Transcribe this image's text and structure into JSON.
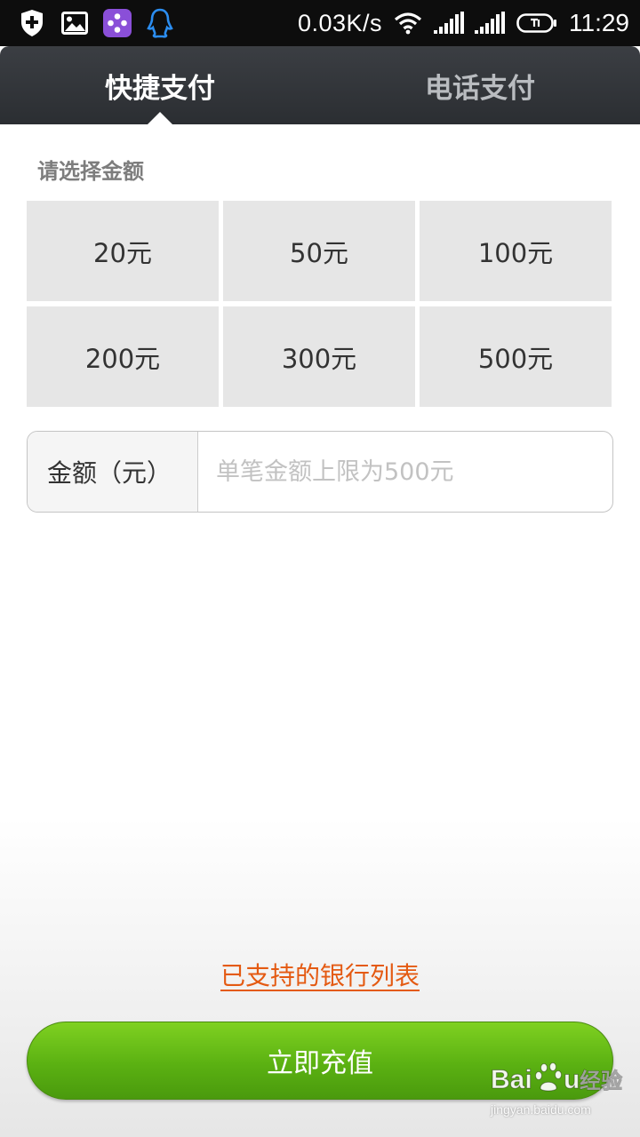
{
  "status_bar": {
    "net_speed": "0.03K/s",
    "time": "11:29",
    "icons": [
      "shield-plus-icon",
      "gallery-icon",
      "game-pad-icon",
      "qq-penguin-icon",
      "wifi-icon",
      "signal-icon",
      "signal-icon",
      "battery-icon"
    ]
  },
  "tabs": {
    "quick_pay": "快捷支付",
    "phone_pay": "电话支付",
    "active": "quick_pay"
  },
  "amount_section": {
    "label": "请选择金额",
    "options": [
      "20元",
      "50元",
      "100元",
      "200元",
      "300元",
      "500元"
    ]
  },
  "amount_field": {
    "label": "金额（元）",
    "placeholder": "单笔金额上限为500元",
    "value": ""
  },
  "bank_list_link": "已支持的银行列表",
  "recharge_button": "立即充值",
  "watermark": {
    "logo_text": "Baidu经验",
    "url": "jingyan.baidu.com"
  },
  "colors": {
    "link": "#e45a12",
    "button_green": "#5bb112",
    "header_dark": "#33363a"
  }
}
